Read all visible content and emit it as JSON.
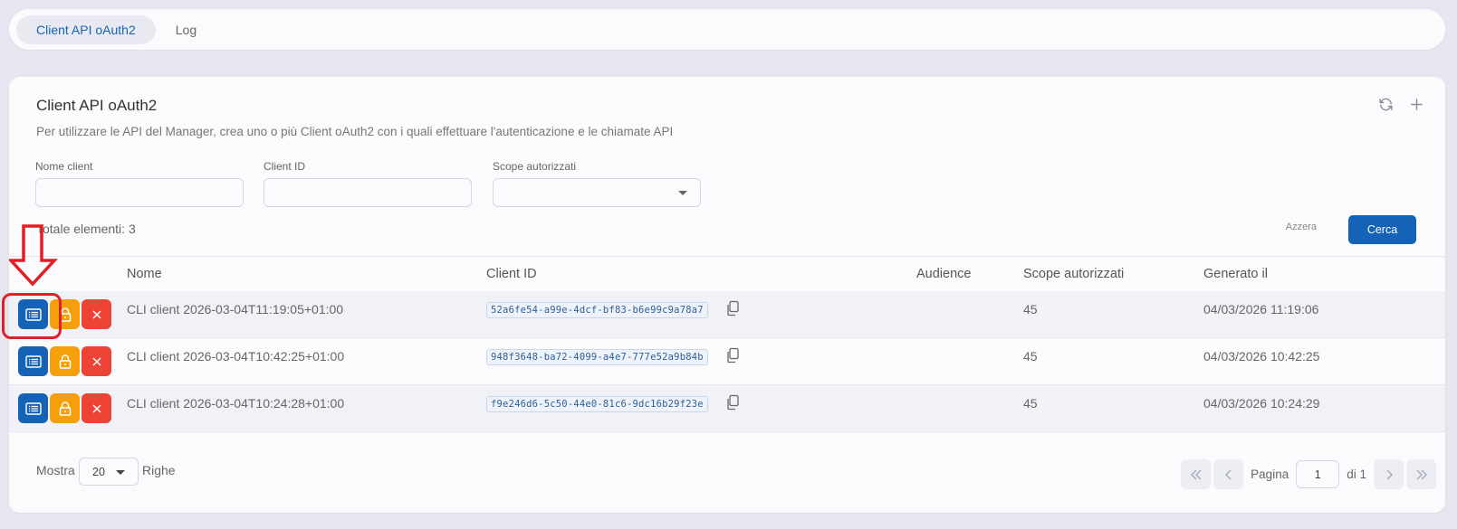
{
  "tabs": [
    {
      "label": "Client API oAuth2",
      "active": true
    },
    {
      "label": "Log",
      "active": false
    }
  ],
  "card": {
    "title": "Client API oAuth2",
    "description": "Per utilizzare le API del Manager, crea uno o più Client oAuth2 con i quali effettuare l'autenticazione e le chiamate API",
    "actions": {
      "refresh_icon": "refresh-icon",
      "add_icon": "plus-icon"
    }
  },
  "filters": {
    "nome_client": {
      "label": "Nome client",
      "value": ""
    },
    "client_id": {
      "label": "Client ID",
      "value": ""
    },
    "scope": {
      "label": "Scope autorizzati",
      "value": ""
    }
  },
  "total": "Totale elementi: 3",
  "buttons": {
    "reset": "Azzera",
    "search": "Cerca"
  },
  "table": {
    "columns": [
      "Nome",
      "Client ID",
      "Audience",
      "Scope autorizzati",
      "Generato il"
    ],
    "rows": [
      {
        "nome": "CLI client 2026-03-04T11:19:05+01:00",
        "client_id": "52a6fe54-a99e-4dcf-bf83-b6e99c9a78a7",
        "audience": "",
        "scope": "45",
        "generato": "04/03/2026 11:19:06"
      },
      {
        "nome": "CLI client 2026-03-04T10:42:25+01:00",
        "client_id": "948f3648-ba72-4099-a4e7-777e52a9b84b",
        "audience": "",
        "scope": "45",
        "generato": "04/03/2026 10:42:25"
      },
      {
        "nome": "CLI client 2026-03-04T10:24:28+01:00",
        "client_id": "f9e246d6-5c50-44e0-81c6-9dc16b29f23e",
        "audience": "",
        "scope": "45",
        "generato": "04/03/2026 10:24:29"
      }
    ]
  },
  "footer": {
    "mostra": "Mostra",
    "page_size": "20",
    "righe": "Righe",
    "pagina": "Pagina",
    "page": "1",
    "of": "di 1"
  },
  "colors": {
    "primary": "#1563b7",
    "warning": "#f59f0b",
    "danger": "#eb4336",
    "annotation": "#e11f26"
  }
}
